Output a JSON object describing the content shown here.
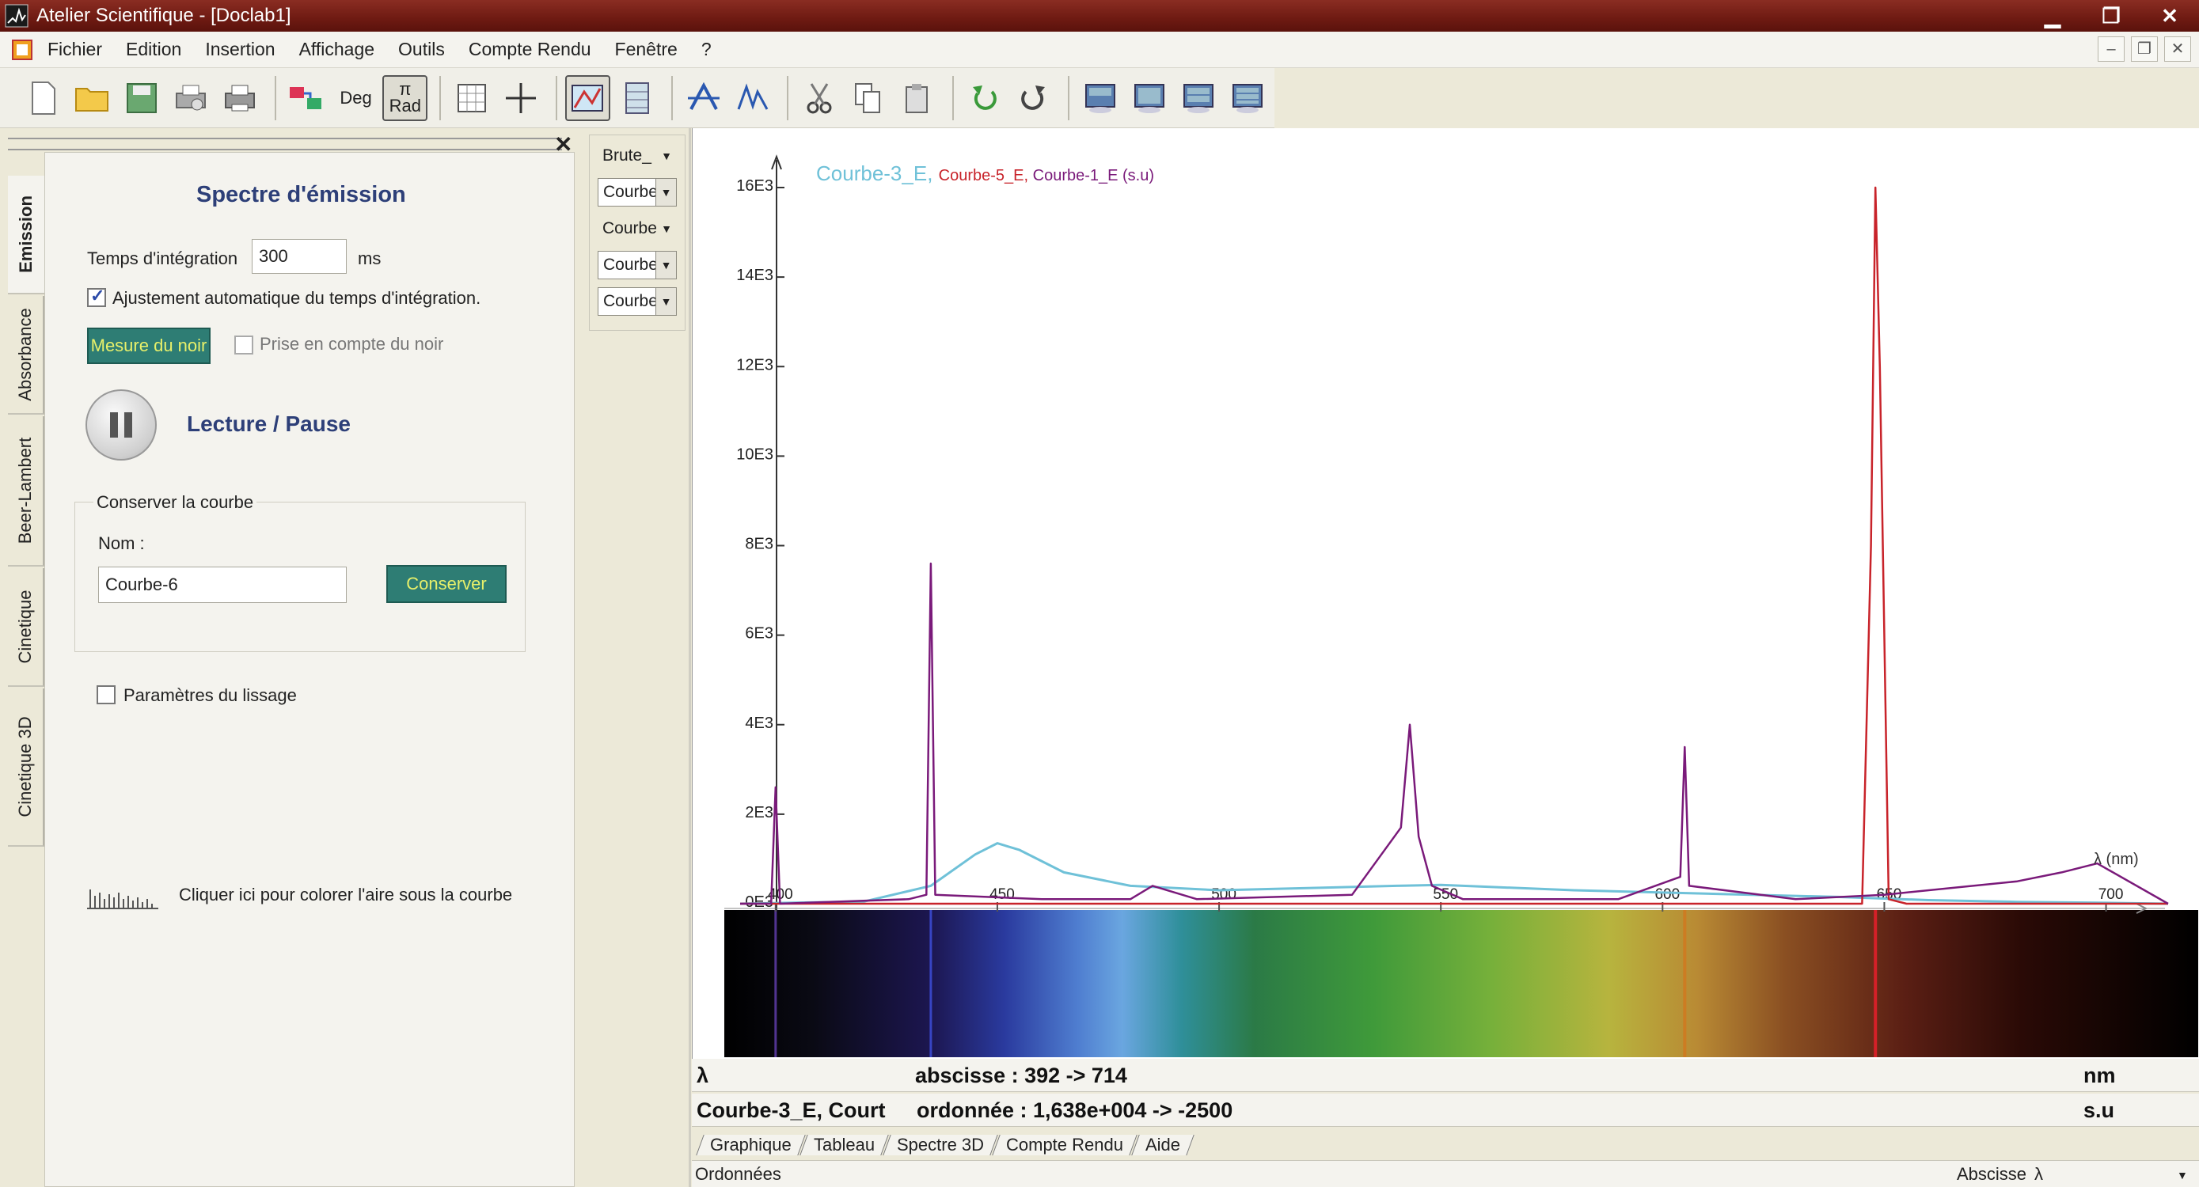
{
  "window": {
    "title": "Atelier Scientifique - [Doclab1]"
  },
  "menu": [
    "Fichier",
    "Edition",
    "Insertion",
    "Affichage",
    "Outils",
    "Compte Rendu",
    "Fenêtre",
    "?"
  ],
  "toolbar": {
    "deg_label": "Deg",
    "rad_label": "Rad",
    "pi_label": "π"
  },
  "left_tabs": [
    "Emission",
    "Absorbance",
    "Beer-Lambert",
    "Cinetique",
    "Cinetique 3D"
  ],
  "panel": {
    "title": "Spectre d'émission",
    "integration_label": "Temps d'intégration",
    "integration_value": "300",
    "integration_unit": "ms",
    "auto_adjust_label": "Ajustement automatique du temps d'intégration.",
    "auto_adjust_checked": true,
    "dark_button": "Mesure du noir",
    "dark_consider_label": "Prise en compte du noir",
    "play_label": "Lecture / Pause",
    "group_title": "Conserver la courbe",
    "name_label": "Nom :",
    "name_value": "Courbe-6",
    "save_button": "Conserver",
    "smoothing_label": "Paramètres du lissage",
    "color_area_label": "Cliquer ici pour colorer l'aire sous la courbe"
  },
  "combos": [
    "Brute_",
    "Courbe",
    "Courbe",
    "Courbe",
    "Courbe"
  ],
  "graph": {
    "legend": [
      "Courbe-3_E",
      "Courbe-5_E",
      "Courbe-1_E (s.u)"
    ],
    "x_unit_label": "λ (nm)",
    "y_ticks": [
      "16E3",
      "14E3",
      "12E3",
      "10E3",
      "8E3",
      "6E3",
      "4E3",
      "2E3",
      "0E3"
    ],
    "x_ticks": [
      "400",
      "450",
      "500",
      "550",
      "600",
      "650",
      "700"
    ],
    "colors": {
      "courbe3": "#6fc1d8",
      "courbe5": "#c8232a",
      "courbe1": "#7a1a7a"
    }
  },
  "chart_data": {
    "type": "line",
    "title": "",
    "xlabel": "λ (nm)",
    "ylabel": "",
    "xlim": [
      392,
      714
    ],
    "ylim": [
      0,
      16380
    ],
    "series": [
      {
        "name": "Courbe-3_E",
        "x": [
          392,
          420,
          435,
          445,
          450,
          455,
          465,
          480,
          500,
          520,
          540,
          550,
          560,
          580,
          600,
          620,
          640,
          660,
          680,
          700,
          714
        ],
        "values": [
          0,
          50,
          400,
          1100,
          1350,
          1200,
          700,
          400,
          300,
          350,
          400,
          420,
          380,
          300,
          250,
          200,
          150,
          80,
          40,
          20,
          0
        ]
      },
      {
        "name": "Courbe-5_E",
        "x": [
          392,
          600,
          645,
          647,
          648,
          649,
          651,
          655,
          700,
          714
        ],
        "values": [
          0,
          0,
          0,
          8000,
          16000,
          12000,
          100,
          0,
          0,
          0
        ]
      },
      {
        "name": "Courbe-1_E (s.u)",
        "x": [
          392,
          399,
          400,
          401,
          430,
          434,
          435,
          436,
          460,
          480,
          485,
          495,
          530,
          541,
          543,
          545,
          548,
          555,
          590,
          604,
          605,
          606,
          630,
          650,
          680,
          690,
          698,
          714
        ],
        "values": [
          0,
          0,
          2600,
          0,
          100,
          200,
          7600,
          200,
          100,
          100,
          400,
          100,
          200,
          1700,
          4000,
          1500,
          400,
          100,
          100,
          600,
          3500,
          400,
          100,
          200,
          500,
          700,
          900,
          0
        ]
      }
    ]
  },
  "info": {
    "lambda_symbol": "λ",
    "abscisse": "abscisse : 392 -> 714",
    "abscisse_unit": "nm",
    "curve_label": "Courbe-3_E, Court",
    "ordonnee": "ordonnée : 1,638e+004 -> -2500",
    "ordonnee_unit": "s.u"
  },
  "bottom_tabs": [
    "Graphique",
    "Tableau",
    "Spectre 3D",
    "Compte Rendu",
    "Aide"
  ],
  "status": {
    "ordonnees": "Ordonnées",
    "abscisse_label": "Abscisse",
    "abscisse_value": "λ"
  }
}
